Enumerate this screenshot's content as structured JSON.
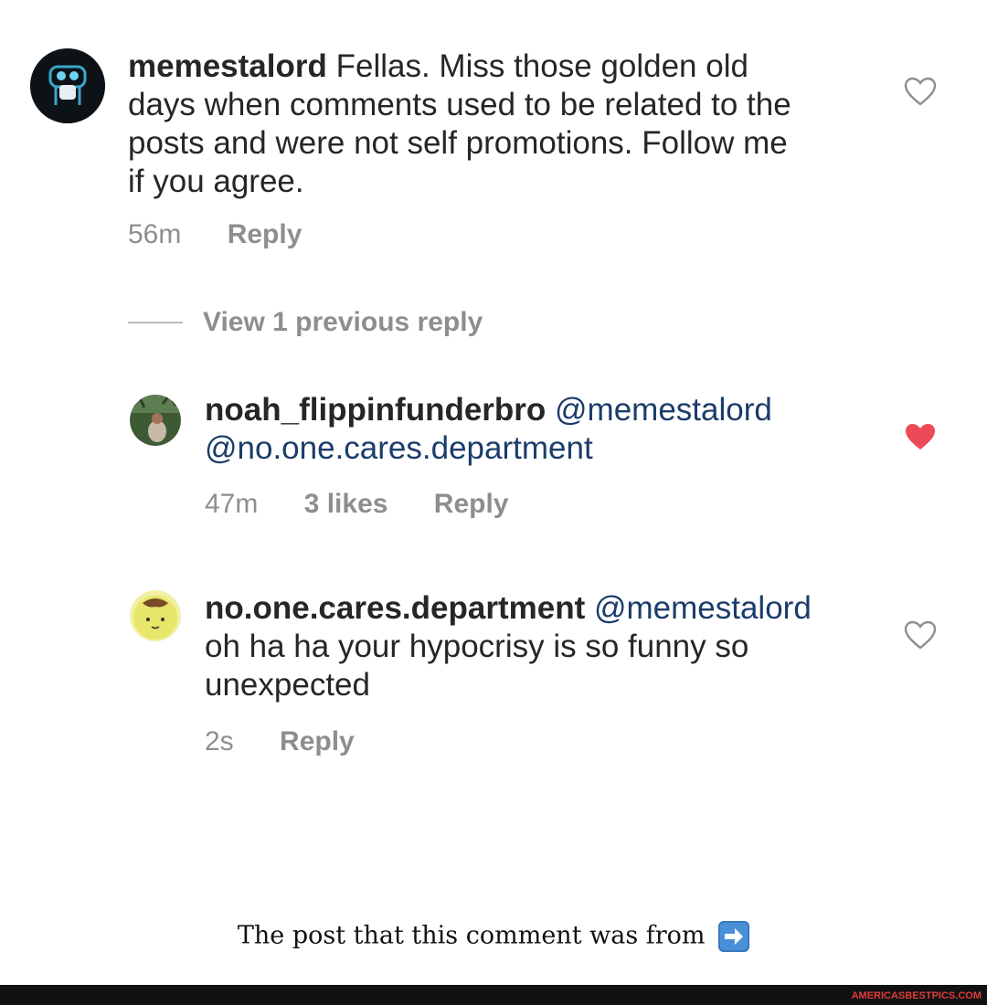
{
  "comments": [
    {
      "username": "memestalord",
      "mentions": [],
      "text_lines": [
        "Fellas. Miss those golden old",
        "days when comments used to be related to the",
        "posts and were not self promotions. Follow me",
        "if you agree."
      ],
      "time": "56m",
      "likes": "",
      "reply_label": "Reply",
      "liked": false
    },
    {
      "username": "noah_flippinfunderbro",
      "mentions": [
        "@memestalord",
        "@no.one.cares.department"
      ],
      "text_lines": [],
      "time": "47m",
      "likes": "3 likes",
      "reply_label": "Reply",
      "liked": true
    },
    {
      "username": "no.one.cares.department",
      "mentions": [
        "@memestalord"
      ],
      "text_lines": [
        "oh ha ha your hypocrisy is so funny so",
        "unexpected"
      ],
      "time": "2s",
      "likes": "",
      "reply_label": "Reply",
      "liked": false
    }
  ],
  "view_previous": "View 1 previous reply",
  "caption": "The post that this comment was from",
  "watermark": "AMERICASBESTPICS.COM",
  "colors": {
    "text": "#262626",
    "meta": "#8e8e8e",
    "mention": "#1b3c6b",
    "heart_liked": "#ed4956",
    "heart_outline": "#8e8e8e"
  },
  "icons": [
    "heart-outline-icon",
    "heart-filled-icon",
    "right-arrow-icon"
  ]
}
